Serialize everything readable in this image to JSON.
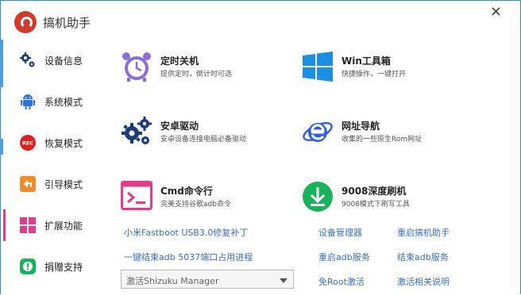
{
  "app": {
    "title": "搞机助手",
    "close_glyph": "×"
  },
  "sidebar": {
    "items": [
      {
        "label": "设备信息",
        "icon": "gears-icon"
      },
      {
        "label": "系统模式",
        "icon": "android-icon"
      },
      {
        "label": "恢复模式",
        "icon": "rec-icon",
        "icon_text": "REC"
      },
      {
        "label": "引导模式",
        "icon": "back-arrow-icon"
      },
      {
        "label": "扩展功能",
        "icon": "grid-icon"
      },
      {
        "label": "捐赠支持",
        "icon": "exclamation-icon"
      }
    ],
    "active_index": 4,
    "colors": {
      "accent": "#e23c8a",
      "edge": "#4a9fe0"
    }
  },
  "tools": [
    {
      "name": "定时关机",
      "desc": "提供定时，倒计时可选",
      "icon": "alarm-clock-icon"
    },
    {
      "name": "Win工具箱",
      "desc": "快捷操作，一键打开",
      "icon": "windows-logo-icon"
    },
    {
      "name": "安卓驱动",
      "desc": "安卓设备连接电脑必备驱动",
      "icon": "driver-gears-icon"
    },
    {
      "name": "网址导航",
      "desc": "收集的一些原生Rom网址",
      "icon": "ie-logo-icon"
    },
    {
      "name": "Cmd命令行",
      "desc": "完美支持谷歌adb命令",
      "icon": "terminal-icon"
    },
    {
      "name": "9008深度刷机",
      "desc": "9008模式下刷写工具",
      "icon": "download-icon"
    }
  ],
  "links": {
    "fastboot_patch": "小米Fastboot USB3.0修复补丁",
    "device_manager": "设备管理器",
    "restart_app": "重启搞机助手",
    "kill_adb_port": "一键结束adb 5037端口占用进程",
    "restart_adb": "重启adb服务",
    "stop_adb": "结束adb服务",
    "root_free_activate": "免Root激活",
    "activate_help": "激活相关说明"
  },
  "shizuku": {
    "selected": "激活Shizuku Manager"
  }
}
